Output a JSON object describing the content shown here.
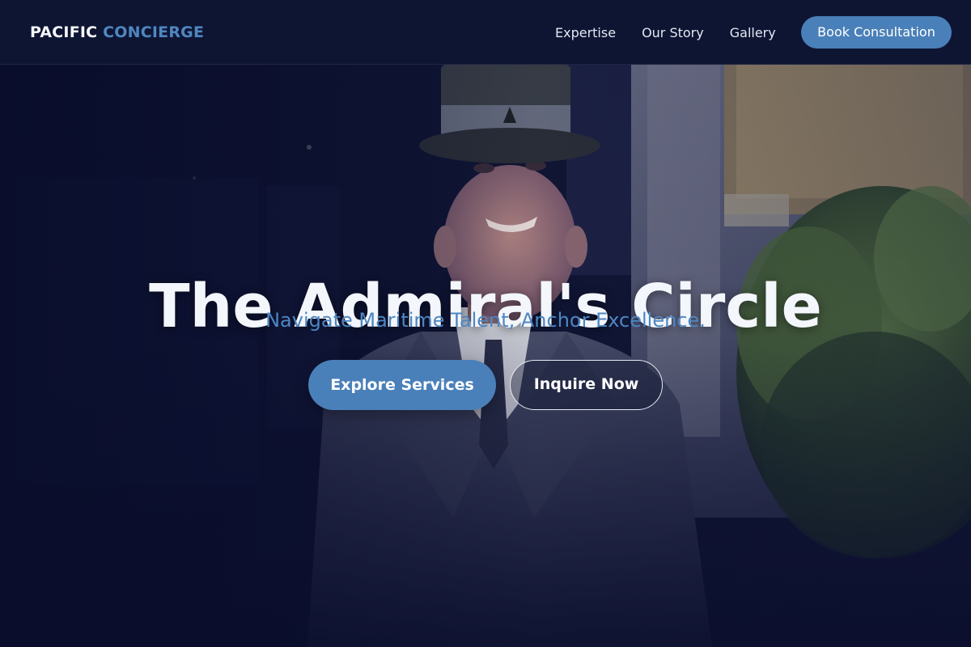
{
  "nav": {
    "brand_primary": "PACIFIC",
    "brand_accent": "CONCIERGE",
    "links": [
      {
        "label": "Expertise"
      },
      {
        "label": "Our Story"
      },
      {
        "label": "Gallery"
      }
    ],
    "cta_label": "Book Consultation"
  },
  "hero": {
    "title": "The Admiral's Circle",
    "subtitle": "Navigate Maritime Talent, Anchor Excellence.",
    "primary_button": "Explore Services",
    "secondary_button": "Inquire Now",
    "background_image": "concierge-in-top-hat-photo"
  },
  "colors": {
    "navy_background": "#0e1533",
    "accent_blue": "#4a80b9",
    "subtitle_blue": "#4d86c2",
    "text_light": "#f3f6fb"
  }
}
